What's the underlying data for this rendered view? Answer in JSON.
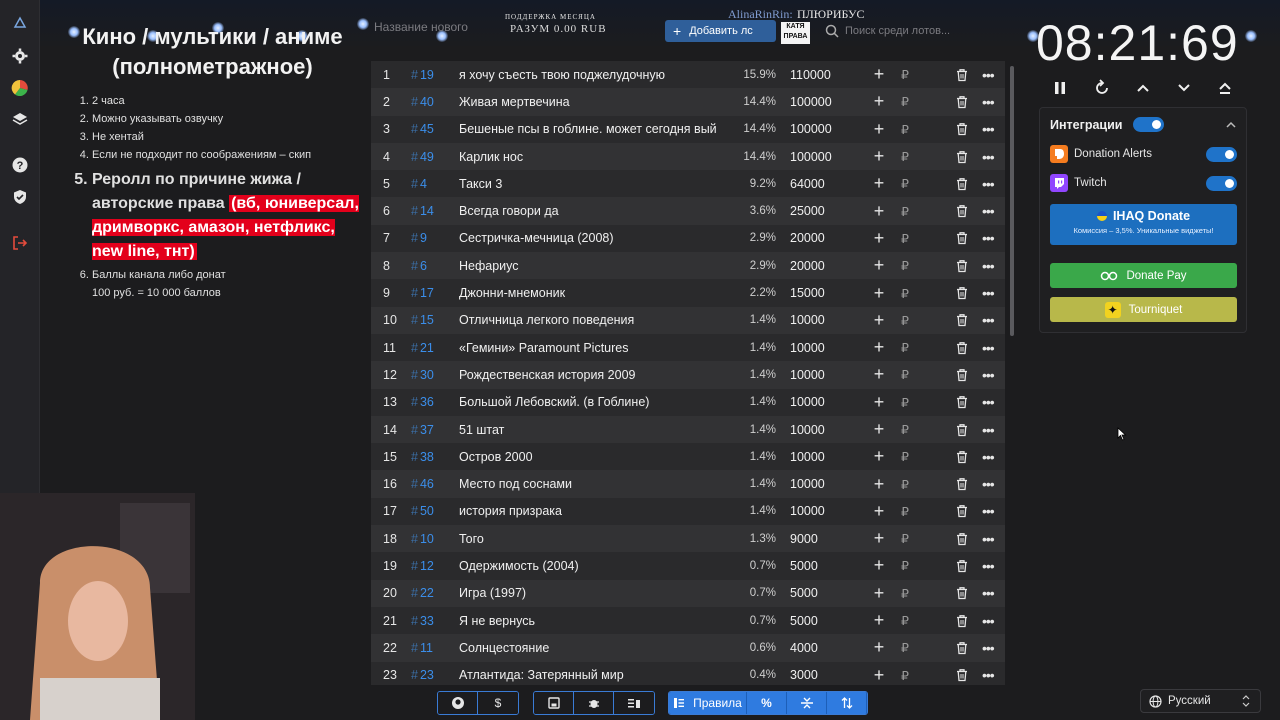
{
  "header": {
    "support_label": "ПОДДЕРЖКА МЕСЯЦА",
    "support_value": "РАЗУМ 0.00 RUB",
    "overlay_user": "AlinaRinRin:",
    "overlay_message": "ПЛЮРИБУС",
    "badge_text": "КАТЯ ПРАВА",
    "name_input_placeholder": "Название нового",
    "add_button_label": "Добавить лс",
    "search_placeholder": "Поиск среди лотов..."
  },
  "rules": {
    "title": "Кино / мультики / аниме (полнометражное)",
    "items": [
      "2 часа",
      "Можно указывать озвучку",
      "Не хентай",
      "Если не подходит по соображениям – скип"
    ],
    "reroll_prefix": "Реролл по причине жижа / авторские права",
    "reroll_highlight": "(вб, юниверсал, дримворкс, амазон, нетфликс, new line, тнт)",
    "points_line1": "Баллы канала либо донат",
    "points_line2": "100 руб. = 10 000 баллов"
  },
  "lots": [
    {
      "n": "1",
      "id": "19",
      "name": "я хочу съесть твою поджелудочную",
      "pct": "15.9%",
      "amount": "110000"
    },
    {
      "n": "2",
      "id": "40",
      "name": "Живая мертвечина",
      "pct": "14.4%",
      "amount": "100000"
    },
    {
      "n": "3",
      "id": "45",
      "name": "Бешеные псы в гоблине. может сегодня вый",
      "pct": "14.4%",
      "amount": "100000"
    },
    {
      "n": "4",
      "id": "49",
      "name": "Карлик нос",
      "pct": "14.4%",
      "amount": "100000"
    },
    {
      "n": "5",
      "id": "4",
      "name": "Такси 3",
      "pct": "9.2%",
      "amount": "64000"
    },
    {
      "n": "6",
      "id": "14",
      "name": "Всегда говори да",
      "pct": "3.6%",
      "amount": "25000"
    },
    {
      "n": "7",
      "id": "9",
      "name": "Сестричка-мечница (2008)",
      "pct": "2.9%",
      "amount": "20000"
    },
    {
      "n": "8",
      "id": "6",
      "name": "Нефариус",
      "pct": "2.9%",
      "amount": "20000"
    },
    {
      "n": "9",
      "id": "17",
      "name": "Джонни-мнемоник",
      "pct": "2.2%",
      "amount": "15000"
    },
    {
      "n": "10",
      "id": "15",
      "name": "Отличница легкого поведения",
      "pct": "1.4%",
      "amount": "10000"
    },
    {
      "n": "11",
      "id": "21",
      "name": "«Гемини» Paramount Pictures",
      "pct": "1.4%",
      "amount": "10000"
    },
    {
      "n": "12",
      "id": "30",
      "name": "Рождественская история 2009",
      "pct": "1.4%",
      "amount": "10000"
    },
    {
      "n": "13",
      "id": "36",
      "name": "Большой Лебовский. (в Гоблине)",
      "pct": "1.4%",
      "amount": "10000"
    },
    {
      "n": "14",
      "id": "37",
      "name": "51 штат",
      "pct": "1.4%",
      "amount": "10000"
    },
    {
      "n": "15",
      "id": "38",
      "name": "Остров 2000",
      "pct": "1.4%",
      "amount": "10000"
    },
    {
      "n": "16",
      "id": "46",
      "name": "Место под соснами",
      "pct": "1.4%",
      "amount": "10000"
    },
    {
      "n": "17",
      "id": "50",
      "name": "история призрака",
      "pct": "1.4%",
      "amount": "10000"
    },
    {
      "n": "18",
      "id": "10",
      "name": "Того",
      "pct": "1.3%",
      "amount": "9000"
    },
    {
      "n": "19",
      "id": "12",
      "name": "Одержимость (2004)",
      "pct": "0.7%",
      "amount": "5000"
    },
    {
      "n": "20",
      "id": "22",
      "name": "Игра (1997)",
      "pct": "0.7%",
      "amount": "5000"
    },
    {
      "n": "21",
      "id": "33",
      "name": "Я не вернусь",
      "pct": "0.7%",
      "amount": "5000"
    },
    {
      "n": "22",
      "id": "11",
      "name": "Солнцестояние",
      "pct": "0.6%",
      "amount": "4000"
    },
    {
      "n": "23",
      "id": "23",
      "name": "Атлантида: Затерянный мир",
      "pct": "0.4%",
      "amount": "3000"
    }
  ],
  "lot_hash": "#",
  "currency": "₽",
  "timer": "08:21:69",
  "integrations": {
    "title": "Интеграции",
    "donation_alerts": "Donation Alerts",
    "twitch": "Twitch",
    "ihaq_title": "IHAQ Donate",
    "ihaq_sub": "Комиссия – 3,5%. Уникальные виджеты!",
    "donate_pay": "Donate Pay",
    "tourniquet": "Tourniquet"
  },
  "toolbar": {
    "rules_label": "Правила",
    "dollar": "$",
    "percent": "%"
  },
  "language": "Русский",
  "colors": {
    "accent": "#2f7be0",
    "id_link": "#3b8eea",
    "highlight": "#e3001b",
    "donate_pay": "#3aa84a",
    "tourniquet": "#b8b84a"
  }
}
